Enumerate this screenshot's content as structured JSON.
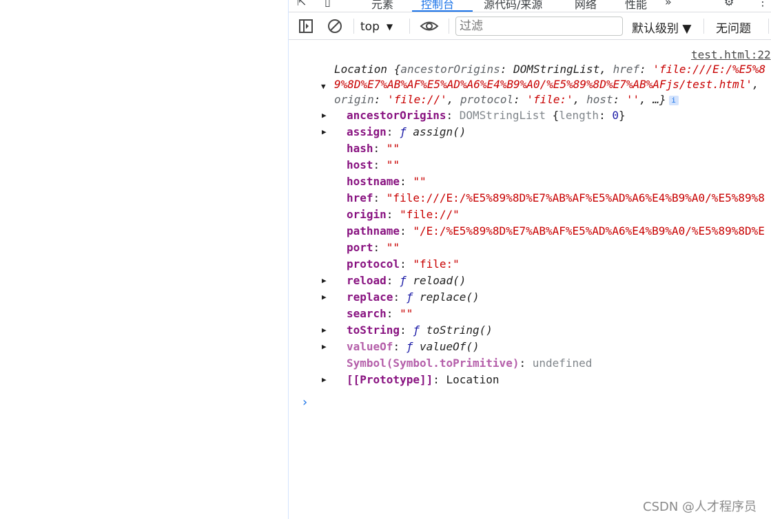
{
  "tabs": {
    "elements": "元素",
    "console": "控制台",
    "sources": "源代码/来源",
    "network": "网络",
    "performance": "性能",
    "more": "»"
  },
  "toolbar": {
    "context": "top",
    "context_arrow": "▼",
    "filter_placeholder": "过滤",
    "level": "默认级别 ▼",
    "issues": "无问题"
  },
  "console": {
    "source_link": "test.html:22",
    "summary": {
      "line1_prefix": "Location {",
      "k_ancestor": "ancestorOrigins",
      "v_ancestor": "DOMStringList",
      "k_href": "href",
      "v_href_part1": "'file:///E:/%E5%8",
      "v_href_part2": "9%8D%E7%AB%AF%E5%AD%A6%E4%B9%A0/%E5%89%8D%E7%AB%AFjs/test.html'",
      "k_origin": "origin",
      "v_origin": "'file://'",
      "k_protocol": "protocol",
      "v_protocol": "'file:'",
      "k_host": "host",
      "v_host": "''",
      "tail": "…}",
      "info": "i"
    },
    "properties": [
      {
        "key": "ancestorOrigins",
        "expandable": true,
        "type": "obj",
        "value": "DOMStringList",
        "extra_key": "length",
        "extra_val": "0"
      },
      {
        "key": "assign",
        "expandable": true,
        "type": "fn",
        "value": "assign()"
      },
      {
        "key": "hash",
        "expandable": false,
        "type": "str",
        "value": "\"\""
      },
      {
        "key": "host",
        "expandable": false,
        "type": "str",
        "value": "\"\""
      },
      {
        "key": "hostname",
        "expandable": false,
        "type": "str",
        "value": "\"\""
      },
      {
        "key": "href",
        "expandable": false,
        "type": "str",
        "value": "\"file:///E:/%E5%89%8D%E7%AB%AF%E5%AD%A6%E4%B9%A0/%E5%89%8"
      },
      {
        "key": "origin",
        "expandable": false,
        "type": "str",
        "value": "\"file://\""
      },
      {
        "key": "pathname",
        "expandable": false,
        "type": "str",
        "value": "\"/E:/%E5%89%8D%E7%AB%AF%E5%AD%A6%E4%B9%A0/%E5%89%8D%E"
      },
      {
        "key": "port",
        "expandable": false,
        "type": "str",
        "value": "\"\""
      },
      {
        "key": "protocol",
        "expandable": false,
        "type": "str",
        "value": "\"file:\""
      },
      {
        "key": "reload",
        "expandable": true,
        "type": "fn",
        "value": "reload()"
      },
      {
        "key": "replace",
        "expandable": true,
        "type": "fn",
        "value": "replace()"
      },
      {
        "key": "search",
        "expandable": false,
        "type": "str",
        "value": "\"\""
      },
      {
        "key": "toString",
        "expandable": true,
        "type": "fn",
        "value": "toString()"
      },
      {
        "key": "valueOf",
        "expandable": true,
        "type": "fn",
        "dim": true,
        "value": "valueOf()"
      },
      {
        "key": "Symbol(Symbol.toPrimitive)",
        "expandable": false,
        "type": "undef",
        "dim": true,
        "value": "undefined"
      },
      {
        "key": "[[Prototype]]",
        "expandable": true,
        "type": "proto",
        "value": "Location"
      }
    ],
    "prompt": "›"
  },
  "watermark": "CSDN @人才程序员",
  "colors": {
    "accent": "#1a73e8",
    "key": "#881280",
    "string": "#c80000"
  }
}
